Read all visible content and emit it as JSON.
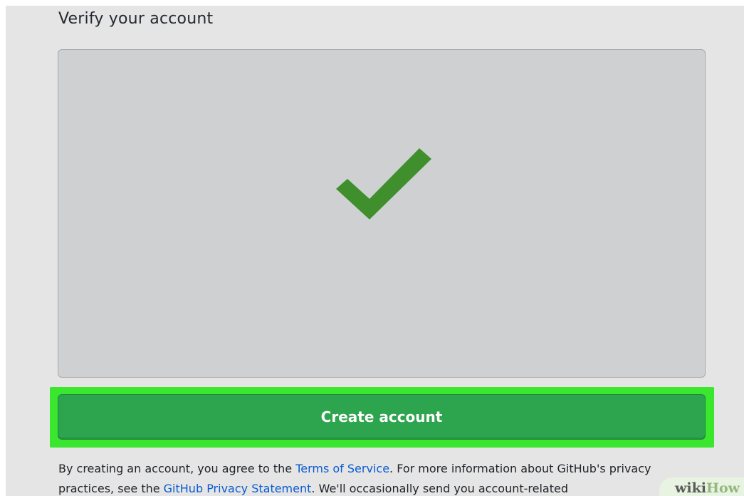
{
  "page": {
    "heading": "Verify your account"
  },
  "verification": {
    "status_icon": "checkmark-icon",
    "check_color": "#3f8f2c"
  },
  "actions": {
    "create_account_label": "Create account",
    "button_color": "#2da44e",
    "highlight_color": "#3be62e"
  },
  "legal": {
    "text_1": "By creating an account, you agree to the ",
    "terms_link": "Terms of Service",
    "text_2": ". For more information about GitHub's privacy practices, see the ",
    "privacy_link": "GitHub Privacy Statement",
    "text_3": ". We'll occasionally send you account-related"
  },
  "watermark": {
    "part1": "wiki",
    "part2": "How"
  }
}
